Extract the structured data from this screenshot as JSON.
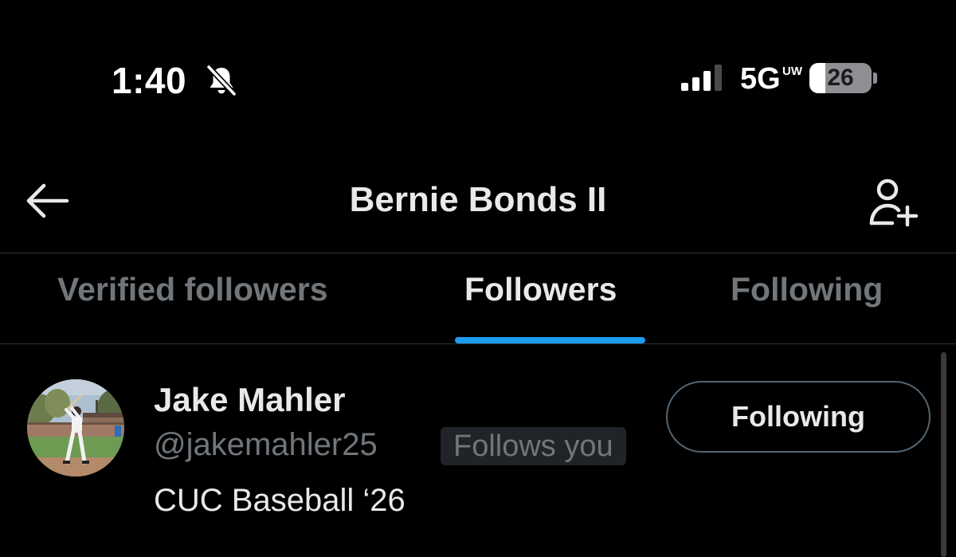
{
  "status_bar": {
    "time": "1:40",
    "network": "5G",
    "network_sub": "UW",
    "battery": "26",
    "battery_level": 0.26,
    "icons": [
      "bell-slash-icon",
      "signal-icon"
    ]
  },
  "header": {
    "title": "Bernie Bonds II",
    "back_icon": "arrow-left-icon",
    "action_icon": "add-user-icon"
  },
  "tabs": [
    {
      "label": "Verified followers",
      "active": false
    },
    {
      "label": "Followers",
      "active": true
    },
    {
      "label": "Following",
      "active": false
    }
  ],
  "colors": {
    "background": "#000000",
    "accent": "#1d9bf0",
    "text_primary": "#e7e9ea",
    "text_secondary": "#71767b"
  },
  "users": [
    {
      "name": "Jake Mahler",
      "handle": "@jakemahler25",
      "badge": "Follows you",
      "bio": "CUC Baseball ‘26",
      "button_label": "Following"
    }
  ]
}
